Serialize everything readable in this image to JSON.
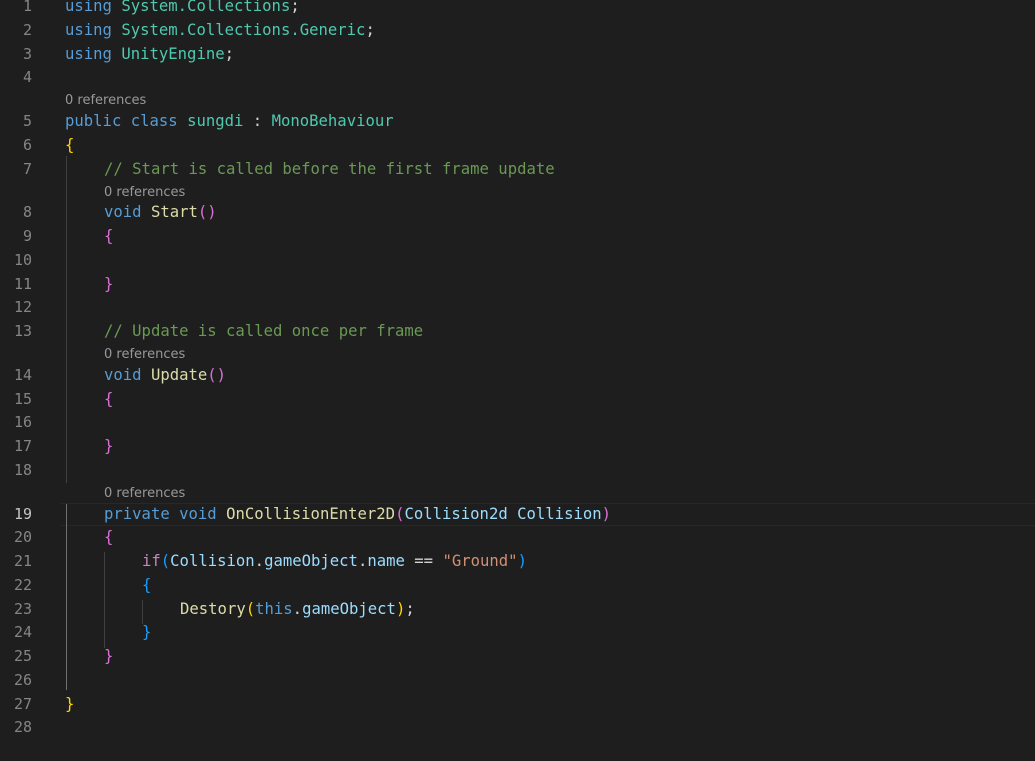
{
  "editor": {
    "active_line": "19",
    "line_numbers": [
      "1",
      "2",
      "3",
      "4",
      "5",
      "6",
      "7",
      "8",
      "9",
      "10",
      "11",
      "12",
      "13",
      "14",
      "15",
      "16",
      "17",
      "18",
      "19",
      "20",
      "21",
      "22",
      "23",
      "24",
      "25",
      "26",
      "27",
      "28"
    ],
    "codelens": "0 references",
    "lines": {
      "l1": {
        "a": "using",
        "b": "System.Collections",
        "c": ";"
      },
      "l2": {
        "a": "using",
        "b": "System.Collections.Generic",
        "c": ";"
      },
      "l3": {
        "a": "using",
        "b": "UnityEngine",
        "c": ";"
      },
      "l5": {
        "a": "public",
        "b": "class",
        "c": "sungdi",
        "d": " : ",
        "e": "MonoBehaviour"
      },
      "l6": {
        "a": "{"
      },
      "l7": {
        "a": "// Start is called before the first frame update"
      },
      "l8": {
        "a": "void",
        "b": "Start",
        "c": "()"
      },
      "l9": {
        "a": "{"
      },
      "l11": {
        "a": "}"
      },
      "l13": {
        "a": "// Update is called once per frame"
      },
      "l14": {
        "a": "void",
        "b": "Update",
        "c": "()"
      },
      "l15": {
        "a": "{"
      },
      "l17": {
        "a": "}"
      },
      "l19": {
        "a": "private",
        "b": "void",
        "c": "OnCollisionEnter2D",
        "d": "(",
        "e": "Collision2d",
        "f": "Collision",
        "g": ")"
      },
      "l20": {
        "a": "{"
      },
      "l21": {
        "a": "if",
        "b": "(",
        "c": "Collision",
        "d": ".",
        "e": "gameObject",
        "f": ".",
        "g": "name",
        "h": " == ",
        "i": "\"Ground\"",
        "j": ")"
      },
      "l22": {
        "a": "{"
      },
      "l23": {
        "a": "Destory",
        "b": "(",
        "c": "this",
        "d": ".",
        "e": "gameObject",
        "f": ")",
        "g": ";"
      },
      "l24": {
        "a": "}"
      },
      "l25": {
        "a": "}"
      },
      "l27": {
        "a": "}"
      }
    }
  },
  "theme": {
    "background": "#1e1e1e",
    "keyword": "#569cd6",
    "control": "#c586c0",
    "type": "#4ec9b0",
    "function": "#dcdcaa",
    "variable": "#9cdcfe",
    "string": "#ce9178",
    "comment": "#6a9955",
    "bracket_1": "#ffd700",
    "bracket_2": "#da70d6",
    "bracket_3": "#179fff"
  }
}
